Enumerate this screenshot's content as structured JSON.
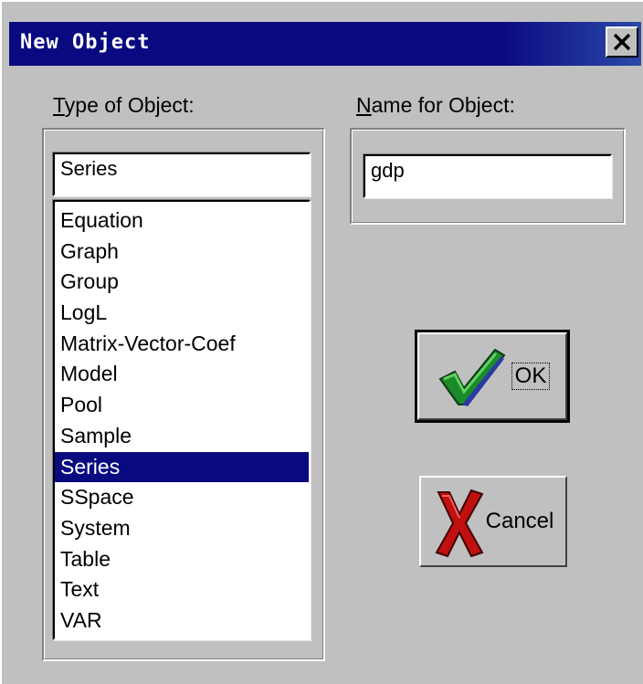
{
  "window": {
    "title": "New Object",
    "close_icon": "close-icon"
  },
  "type_panel": {
    "label_mnemonic": "T",
    "label_rest": "ype of Object:",
    "selected_value": "Series",
    "items": [
      "Equation",
      "Graph",
      "Group",
      "LogL",
      "Matrix-Vector-Coef",
      "Model",
      "Pool",
      "Sample",
      "Series",
      "SSpace",
      "System",
      "Table",
      "Text",
      "VAR"
    ],
    "selected_index": 8
  },
  "name_panel": {
    "label_mnemonic": "N",
    "label_rest": "ame for Object:",
    "value": "gdp"
  },
  "buttons": {
    "ok_label": "OK",
    "ok_icon": "checkmark-icon",
    "cancel_label": "Cancel",
    "cancel_icon": "red-x-icon"
  },
  "colors": {
    "titlebar": "#0a0a80",
    "selection": "#0a0a80",
    "face": "#c0c0c0"
  }
}
